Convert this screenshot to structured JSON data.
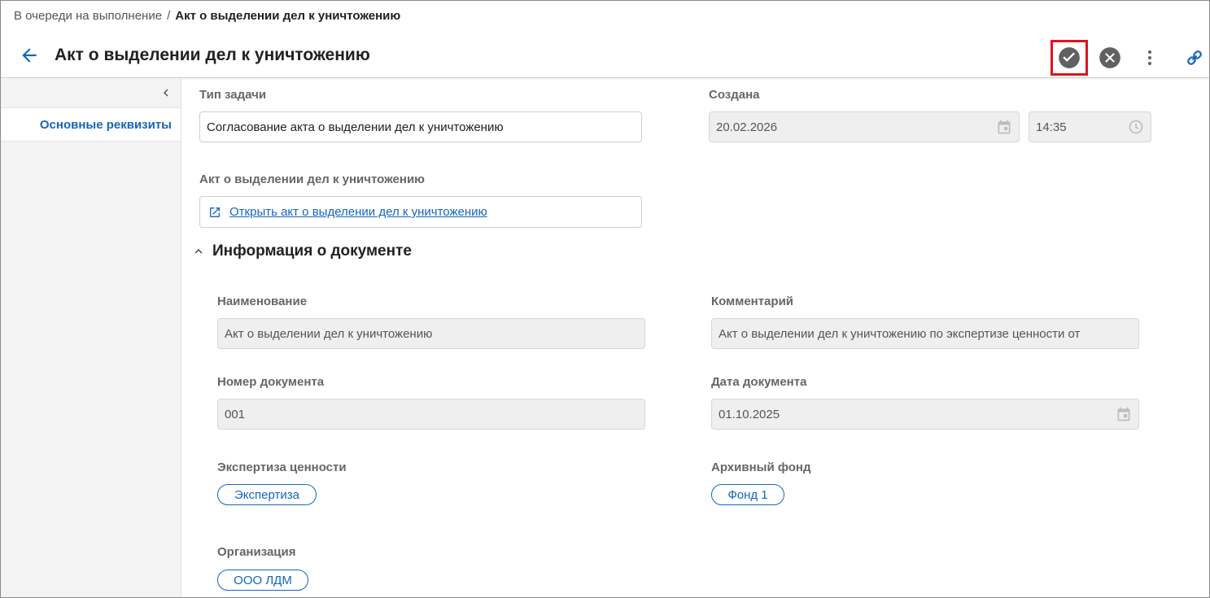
{
  "breadcrumb": {
    "parent": "В очереди на выполнение",
    "separator": "/",
    "current": "Акт о выделении дел к уничтожению"
  },
  "header": {
    "title": "Акт о выделении дел к уничтожению",
    "icons": {
      "back": "arrow-left-icon",
      "approve": "check-circle-icon",
      "reject": "close-circle-icon",
      "more": "more-vertical-icon",
      "link": "link-icon"
    }
  },
  "sidebar": {
    "items": [
      {
        "label": "Основные реквизиты",
        "active": true
      }
    ]
  },
  "form": {
    "task_type": {
      "label": "Тип задачи",
      "value": "Согласование акта о выделении дел к уничтожению"
    },
    "created": {
      "label": "Создана",
      "date": "20.02.2026",
      "time": "14:35"
    },
    "act": {
      "label": "Акт о выделении дел к уничтожению",
      "link_text": "Открыть акт о выделении дел к уничтожению"
    }
  },
  "doc_section": {
    "title": "Информация о документе",
    "name": {
      "label": "Наименование",
      "value": "Акт о выделении дел к уничтожению"
    },
    "comment": {
      "label": "Комментарий",
      "value": "Акт о выделении дел к уничтожению по экспертизе ценности от"
    },
    "doc_number": {
      "label": "Номер документа",
      "value": "001"
    },
    "doc_date": {
      "label": "Дата документа",
      "value": "01.10.2025"
    },
    "expertise": {
      "label": "Экспертиза ценности",
      "chip": "Экспертиза"
    },
    "fund": {
      "label": "Архивный фонд",
      "chip": "Фонд 1"
    },
    "organization": {
      "label": "Организация",
      "chip": "ООО ЛДМ"
    }
  },
  "colors": {
    "accent": "#1565c0",
    "highlight_border": "#e0141e",
    "readonly_bg": "#efefef",
    "sidebar_bg": "#f3f3f3"
  }
}
